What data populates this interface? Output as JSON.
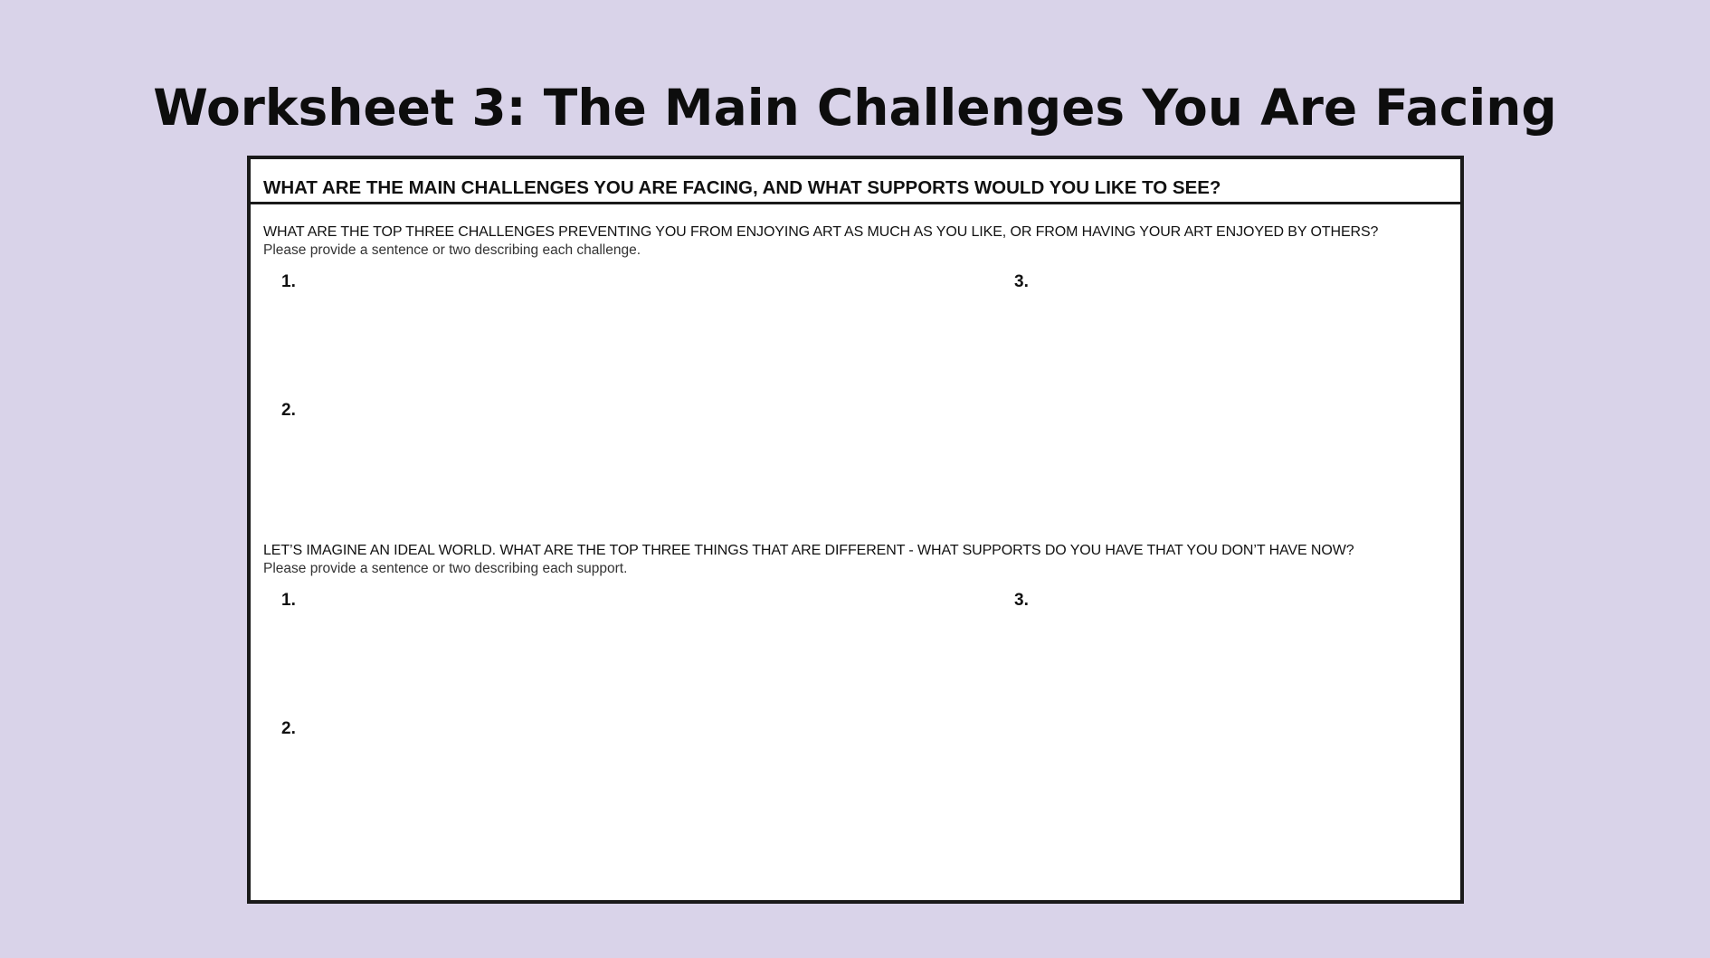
{
  "page": {
    "title": "Worksheet 3: The Main Challenges You Are Facing"
  },
  "worksheet": {
    "header": "WHAT ARE THE MAIN CHALLENGES YOU ARE FACING, AND WHAT SUPPORTS WOULD YOU LIKE TO SEE?",
    "sections": [
      {
        "question": "WHAT ARE THE TOP THREE CHALLENGES PREVENTING YOU FROM ENJOYING ART AS MUCH AS YOU LIKE, OR FROM HAVING YOUR ART ENJOYED BY OTHERS?",
        "hint": "Please provide a sentence or two describing each challenge.",
        "answers": [
          {
            "label": "1.",
            "value": ""
          },
          {
            "label": "2.",
            "value": ""
          },
          {
            "label": "3.",
            "value": ""
          }
        ]
      },
      {
        "question": "LET’S IMAGINE AN IDEAL WORLD. WHAT ARE THE TOP THREE THINGS THAT ARE DIFFERENT - WHAT SUPPORTS DO YOU HAVE THAT YOU DON’T HAVE NOW?",
        "hint": "Please provide a sentence or two describing each support.",
        "answers": [
          {
            "label": "1.",
            "value": ""
          },
          {
            "label": "2.",
            "value": ""
          },
          {
            "label": "3.",
            "value": ""
          }
        ]
      }
    ]
  },
  "colors": {
    "background": "#d9d3e9",
    "sheet": "#ffffff",
    "border": "#1a1a1a",
    "text": "#111111"
  }
}
